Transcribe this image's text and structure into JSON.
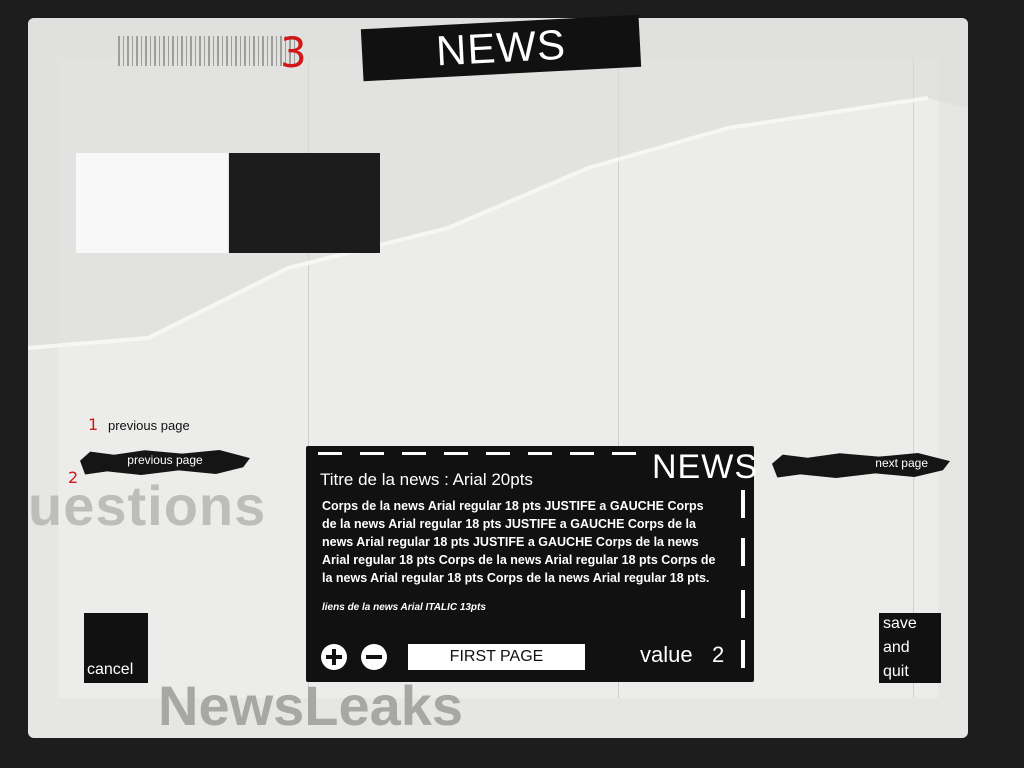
{
  "header": {
    "title": "NEWS"
  },
  "annotations": {
    "marker_3": "3",
    "marker_1": "1",
    "marker_2": "2"
  },
  "navigation": {
    "previous_label_top": "previous page",
    "previous_button": "previous page",
    "next_button": "next page"
  },
  "news_panel": {
    "heading": "NEWS",
    "title": "Titre de la news : Arial 20pts",
    "body": "Corps de la news Arial regular 18 pts JUSTIFE a GAUCHE Corps de la news Arial regular 18 pts JUSTIFE a GAUCHE Corps de la news Arial regular 18 pts JUSTIFE a GAUCHE Corps de la news Arial regular 18 pts Corps de la news Arial regular 18 pts Corps de la news Arial regular 18 pts Corps de la news Arial regular 18 pts.",
    "link": "liens de la news Arial  ITALIC 13pts",
    "first_page_button": "FIRST PAGE",
    "value_label": "value",
    "value": "2"
  },
  "actions": {
    "cancel": "cancel",
    "save_quit": "save\nand\nquit"
  },
  "background_text": {
    "ghost_word": "uestions",
    "brand": "NewsLeaks"
  },
  "colors": {
    "panel": "#111111",
    "paper": "#e6e6e4",
    "annotation": "#d01818"
  }
}
